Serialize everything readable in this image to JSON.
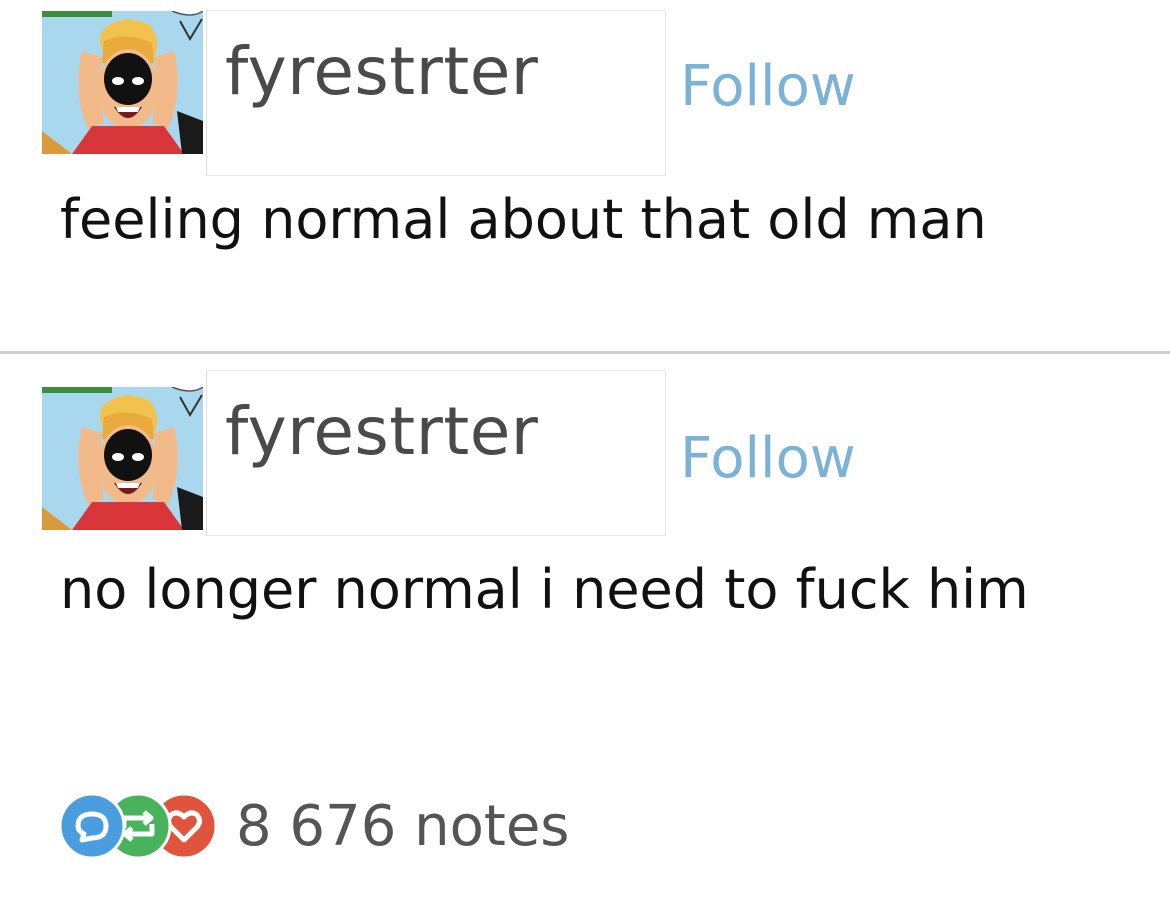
{
  "posts": [
    {
      "username": "fyrestrter",
      "follow_label": "Follow",
      "text": "feeling normal about that old man",
      "avatar_icon": "comic-avatar-icon"
    },
    {
      "username": "fyrestrter",
      "follow_label": "Follow",
      "text": "no longer normal i need to fuck him",
      "avatar_icon": "comic-avatar-icon"
    }
  ],
  "notes": {
    "count_label": "8 676 notes",
    "icons": [
      "reply-icon",
      "reblog-icon",
      "like-icon"
    ]
  },
  "colors": {
    "follow": "#7bb2d6",
    "reply": "#4a9ee0",
    "reblog": "#48b35a",
    "like": "#e0533d"
  }
}
